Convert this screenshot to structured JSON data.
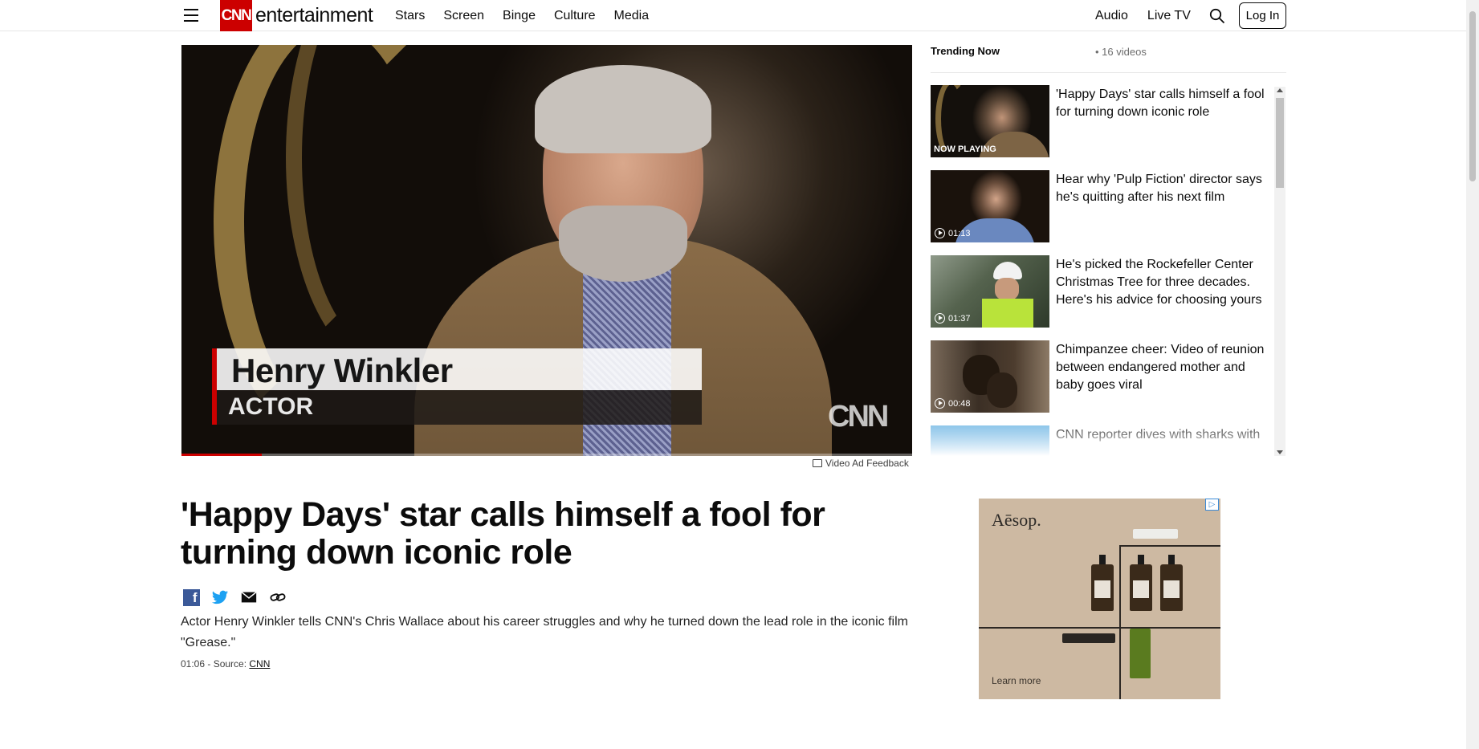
{
  "header": {
    "logo_text": "CNN",
    "section": "entertainment",
    "nav": [
      "Stars",
      "Screen",
      "Binge",
      "Culture",
      "Media"
    ],
    "nav_right": [
      "Audio",
      "Live TV"
    ],
    "login_label": "Log In"
  },
  "video": {
    "lower_third_name": "Henry Winkler",
    "lower_third_role": "ACTOR",
    "network_bug": "CNN",
    "progress_fraction": 0.11,
    "ad_feedback": "Video Ad Feedback"
  },
  "article": {
    "headline": "'Happy Days' star calls himself a fool for turning down iconic role",
    "description": "Actor Henry Winkler tells CNN's Chris Wallace about his career struggles and why he turned down the lead role in the iconic film \"Grease.\"",
    "duration": "01:06",
    "source_prefix": " - Source: ",
    "source": "CNN",
    "share_icons": [
      "facebook-icon",
      "twitter-icon",
      "email-icon",
      "link-icon"
    ]
  },
  "sidebar": {
    "title": "Trending Now",
    "count": "16 videos",
    "items": [
      {
        "title": "'Happy Days' star calls himself a fool for turning down iconic role",
        "badge": "NOW PLAYING"
      },
      {
        "title": "Hear why 'Pulp Fiction' director says he's quitting after his next film",
        "duration": "01:13"
      },
      {
        "title": "He's picked the Rockefeller Center Christmas Tree for three decades. Here's his advice for choosing yours",
        "duration": "01:37"
      },
      {
        "title": "Chimpanzee cheer: Video of reunion between endangered mother and baby goes viral",
        "duration": "00:48"
      },
      {
        "title": "CNN reporter dives with sharks with"
      }
    ]
  },
  "ad": {
    "brand": "Aēsop.",
    "cta": "Learn more",
    "choice": "▷"
  },
  "colors": {
    "brand_red": "#cc0000",
    "facebook": "#3b5998",
    "twitter": "#1da1f2"
  }
}
